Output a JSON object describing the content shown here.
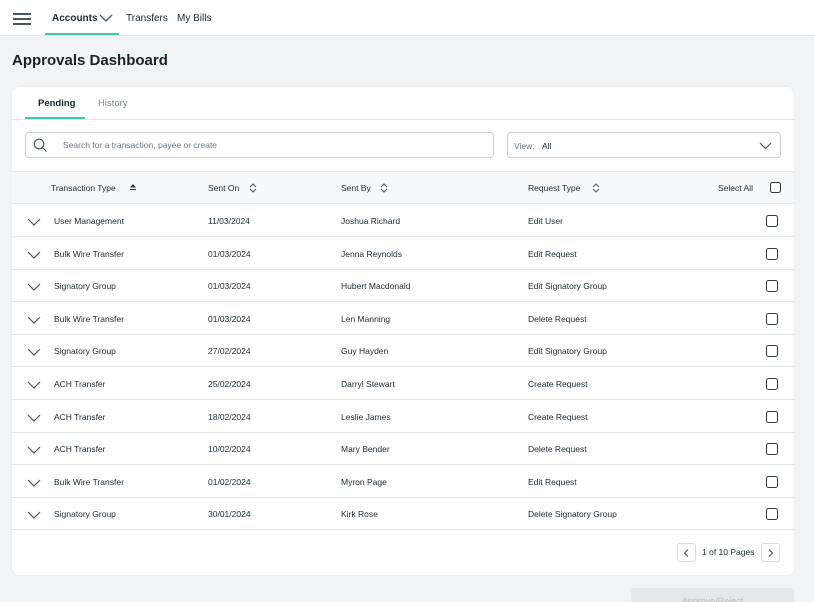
{
  "nav": {
    "items": [
      {
        "label": "Accounts"
      },
      {
        "label": "Transfers"
      },
      {
        "label": "My Bills"
      }
    ]
  },
  "page": {
    "title": "Approvals Dashboard"
  },
  "tabs": [
    {
      "label": "Pending",
      "active": true
    },
    {
      "label": "History",
      "active": false
    }
  ],
  "search": {
    "placeholder": "Search for a transaction, payee or create",
    "value": ""
  },
  "view": {
    "label": "View:",
    "value": "All"
  },
  "table": {
    "headers": {
      "transaction_type": "Transaction Type",
      "sent_on": "Sent On",
      "sent_by": "Sent By",
      "request_type": "Request Type",
      "select_all": "Select All"
    },
    "rows": [
      {
        "type": "User Management",
        "sent_on": "11/03/2024",
        "sent_by": "Joshua Richard",
        "request": "Edit User"
      },
      {
        "type": "Bulk Wire Transfer",
        "sent_on": "01/03/2024",
        "sent_by": "Jenna Reynolds",
        "request": "Edit Request"
      },
      {
        "type": "Signatory Group",
        "sent_on": "01/03/2024",
        "sent_by": "Hubert Macdonald",
        "request": "Edit Signatory Group"
      },
      {
        "type": "Bulk Wire Transfer",
        "sent_on": "01/03/2024",
        "sent_by": "Len Manning",
        "request": "Delete Request"
      },
      {
        "type": "Signatory Group",
        "sent_on": "27/02/2024",
        "sent_by": "Guy Hayden",
        "request": "Edit Signatory Group"
      },
      {
        "type": "ACH Transfer",
        "sent_on": "25/02/2024",
        "sent_by": "Darryl Stewart",
        "request": "Create Request"
      },
      {
        "type": "ACH Transfer",
        "sent_on": "18/02/2024",
        "sent_by": "Leslie James",
        "request": "Create Request"
      },
      {
        "type": "ACH Transfer",
        "sent_on": "10/02/2024",
        "sent_by": "Mary Bender",
        "request": "Delete Request"
      },
      {
        "type": "Bulk Wire Transfer",
        "sent_on": "01/02/2024",
        "sent_by": "Myron Page",
        "request": "Edit Request"
      },
      {
        "type": "Signatory Group",
        "sent_on": "30/01/2024",
        "sent_by": "Kirk Rose",
        "request": "Delete Signatory Group"
      }
    ]
  },
  "pagination": {
    "text": "1 of 10 Pages"
  },
  "actions": {
    "approve_reject": "Approve/Reject"
  },
  "colors": {
    "accent": "#3fc7a6",
    "background": "#f1f3f5",
    "text": "#1d2a33"
  }
}
